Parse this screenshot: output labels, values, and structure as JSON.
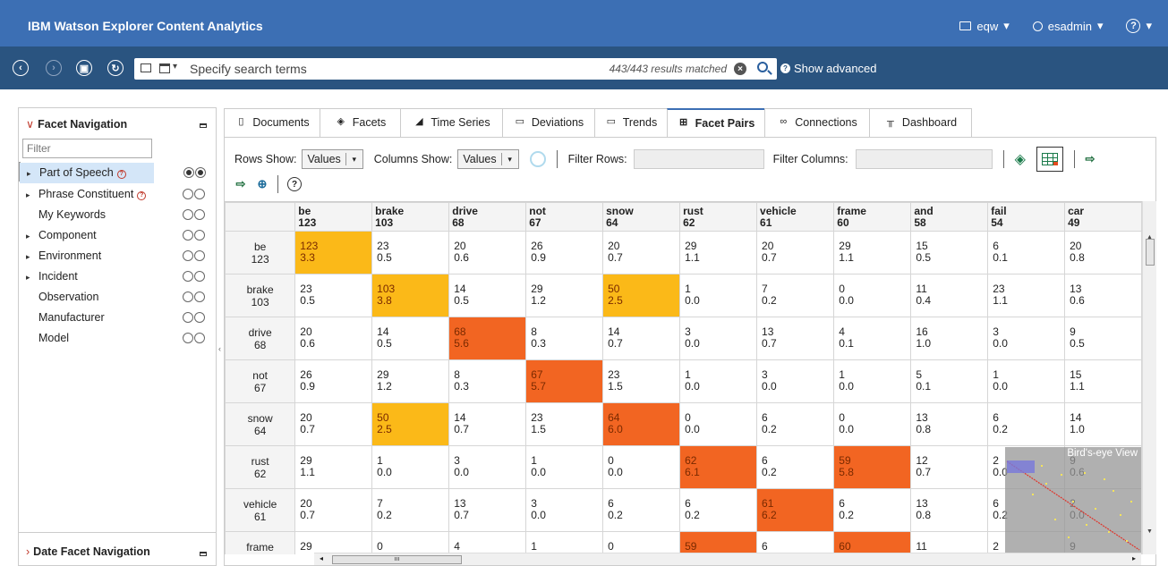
{
  "app": {
    "title": "IBM Watson Explorer Content Analytics"
  },
  "header_right": {
    "collection": "eqw",
    "user": "esadmin",
    "help_caret": "▾",
    "caret": "▾"
  },
  "search": {
    "placeholder": "Specify search terms",
    "results": "443/443 results matched",
    "show_advanced": "Show advanced"
  },
  "facet_nav": {
    "title": "Facet Navigation",
    "filter_placeholder": "Filter",
    "items": [
      {
        "label": "Part of Speech",
        "expandable": true,
        "warn": true,
        "selected": true
      },
      {
        "label": "Phrase Constituent",
        "expandable": true,
        "warn": true,
        "selected": false
      },
      {
        "label": "My Keywords",
        "expandable": false,
        "warn": false,
        "selected": false
      },
      {
        "label": "Component",
        "expandable": true,
        "warn": false,
        "selected": false
      },
      {
        "label": "Environment",
        "expandable": true,
        "warn": false,
        "selected": false
      },
      {
        "label": "Incident",
        "expandable": true,
        "warn": false,
        "selected": false
      },
      {
        "label": "Observation",
        "expandable": false,
        "warn": false,
        "selected": false
      },
      {
        "label": "Manufacturer",
        "expandable": false,
        "warn": false,
        "selected": false
      },
      {
        "label": "Model",
        "expandable": false,
        "warn": false,
        "selected": false
      }
    ],
    "date_title": "Date Facet Navigation"
  },
  "tabs": [
    {
      "label": "Documents",
      "icon": "document-icon",
      "glyph": "▯"
    },
    {
      "label": "Facets",
      "icon": "facets-icon",
      "glyph": "◈"
    },
    {
      "label": "Time Series",
      "icon": "time-series-icon",
      "glyph": "◢"
    },
    {
      "label": "Deviations",
      "icon": "deviations-icon",
      "glyph": "▭"
    },
    {
      "label": "Trends",
      "icon": "trends-icon",
      "glyph": "▭"
    },
    {
      "label": "Facet Pairs",
      "icon": "facet-pairs-icon",
      "glyph": "⊞",
      "active": true
    },
    {
      "label": "Connections",
      "icon": "connections-icon",
      "glyph": "∞"
    },
    {
      "label": "Dashboard",
      "icon": "dashboard-icon",
      "glyph": "╥"
    }
  ],
  "toolbar": {
    "rows_show_label": "Rows Show:",
    "rows_show_value": "Values",
    "cols_show_label": "Columns Show:",
    "cols_show_value": "Values",
    "filter_rows_label": "Filter Rows:",
    "filter_cols_label": "Filter Columns:",
    "caret": "▾",
    "help": "?"
  },
  "matrix": {
    "columns": [
      {
        "term": "be",
        "count": "123"
      },
      {
        "term": "brake",
        "count": "103"
      },
      {
        "term": "drive",
        "count": "68"
      },
      {
        "term": "not",
        "count": "67"
      },
      {
        "term": "snow",
        "count": "64"
      },
      {
        "term": "rust",
        "count": "62"
      },
      {
        "term": "vehicle",
        "count": "61"
      },
      {
        "term": "frame",
        "count": "60"
      },
      {
        "term": "and",
        "count": "58"
      },
      {
        "term": "fail",
        "count": "54"
      },
      {
        "term": "car",
        "count": "49"
      }
    ],
    "rows": [
      {
        "term": "be",
        "count": "123",
        "cells": [
          [
            "123",
            "3.3",
            "y"
          ],
          [
            "23",
            "0.5",
            ""
          ],
          [
            "20",
            "0.6",
            ""
          ],
          [
            "26",
            "0.9",
            ""
          ],
          [
            "20",
            "0.7",
            ""
          ],
          [
            "29",
            "1.1",
            ""
          ],
          [
            "20",
            "0.7",
            ""
          ],
          [
            "29",
            "1.1",
            ""
          ],
          [
            "15",
            "0.5",
            ""
          ],
          [
            "6",
            "0.1",
            ""
          ],
          [
            "20",
            "0.8",
            ""
          ]
        ]
      },
      {
        "term": "brake",
        "count": "103",
        "cells": [
          [
            "23",
            "0.5",
            ""
          ],
          [
            "103",
            "3.8",
            "y"
          ],
          [
            "14",
            "0.5",
            ""
          ],
          [
            "29",
            "1.2",
            ""
          ],
          [
            "50",
            "2.5",
            "y"
          ],
          [
            "1",
            "0.0",
            ""
          ],
          [
            "7",
            "0.2",
            ""
          ],
          [
            "0",
            "0.0",
            ""
          ],
          [
            "11",
            "0.4",
            ""
          ],
          [
            "23",
            "1.1",
            ""
          ],
          [
            "13",
            "0.6",
            ""
          ]
        ]
      },
      {
        "term": "drive",
        "count": "68",
        "cells": [
          [
            "20",
            "0.6",
            ""
          ],
          [
            "14",
            "0.5",
            ""
          ],
          [
            "68",
            "5.6",
            "o"
          ],
          [
            "8",
            "0.3",
            ""
          ],
          [
            "14",
            "0.7",
            ""
          ],
          [
            "3",
            "0.0",
            ""
          ],
          [
            "13",
            "0.7",
            ""
          ],
          [
            "4",
            "0.1",
            ""
          ],
          [
            "16",
            "1.0",
            ""
          ],
          [
            "3",
            "0.0",
            ""
          ],
          [
            "9",
            "0.5",
            ""
          ]
        ]
      },
      {
        "term": "not",
        "count": "67",
        "cells": [
          [
            "26",
            "0.9",
            ""
          ],
          [
            "29",
            "1.2",
            ""
          ],
          [
            "8",
            "0.3",
            ""
          ],
          [
            "67",
            "5.7",
            "o"
          ],
          [
            "23",
            "1.5",
            ""
          ],
          [
            "1",
            "0.0",
            ""
          ],
          [
            "3",
            "0.0",
            ""
          ],
          [
            "1",
            "0.0",
            ""
          ],
          [
            "5",
            "0.1",
            ""
          ],
          [
            "1",
            "0.0",
            ""
          ],
          [
            "15",
            "1.1",
            ""
          ]
        ]
      },
      {
        "term": "snow",
        "count": "64",
        "cells": [
          [
            "20",
            "0.7",
            ""
          ],
          [
            "50",
            "2.5",
            "y"
          ],
          [
            "14",
            "0.7",
            ""
          ],
          [
            "23",
            "1.5",
            ""
          ],
          [
            "64",
            "6.0",
            "o"
          ],
          [
            "0",
            "0.0",
            ""
          ],
          [
            "6",
            "0.2",
            ""
          ],
          [
            "0",
            "0.0",
            ""
          ],
          [
            "13",
            "0.8",
            ""
          ],
          [
            "6",
            "0.2",
            ""
          ],
          [
            "14",
            "1.0",
            ""
          ]
        ]
      },
      {
        "term": "rust",
        "count": "62",
        "cells": [
          [
            "29",
            "1.1",
            ""
          ],
          [
            "1",
            "0.0",
            ""
          ],
          [
            "3",
            "0.0",
            ""
          ],
          [
            "1",
            "0.0",
            ""
          ],
          [
            "0",
            "0.0",
            ""
          ],
          [
            "62",
            "6.1",
            "o"
          ],
          [
            "6",
            "0.2",
            ""
          ],
          [
            "59",
            "5.8",
            "o"
          ],
          [
            "12",
            "0.7",
            ""
          ],
          [
            "2",
            "0.0",
            ""
          ],
          [
            "9",
            "0.6",
            ""
          ]
        ]
      },
      {
        "term": "vehicle",
        "count": "61",
        "cells": [
          [
            "20",
            "0.7",
            ""
          ],
          [
            "7",
            "0.2",
            ""
          ],
          [
            "13",
            "0.7",
            ""
          ],
          [
            "3",
            "0.0",
            ""
          ],
          [
            "6",
            "0.2",
            ""
          ],
          [
            "6",
            "0.2",
            ""
          ],
          [
            "61",
            "6.2",
            "o"
          ],
          [
            "6",
            "0.2",
            ""
          ],
          [
            "13",
            "0.8",
            ""
          ],
          [
            "6",
            "0.2",
            ""
          ],
          [
            "2",
            "0.0",
            ""
          ]
        ]
      },
      {
        "term": "frame",
        "count": "",
        "cells": [
          [
            "29",
            ""
          ],
          [
            "0",
            ""
          ],
          [
            "4",
            ""
          ],
          [
            "1",
            ""
          ],
          [
            "0",
            ""
          ],
          [
            "59",
            "",
            "o"
          ],
          [
            "6",
            ""
          ],
          [
            "60",
            "",
            "o"
          ],
          [
            "11",
            ""
          ],
          [
            "2",
            ""
          ],
          [
            "9",
            ""
          ]
        ]
      }
    ]
  },
  "birdseye": {
    "title": "Bird's-eye View"
  },
  "colors": {
    "title_bar": "#3c6fb4",
    "search_bar": "#2a5480",
    "high": "#f26522",
    "medium": "#fbb918"
  }
}
